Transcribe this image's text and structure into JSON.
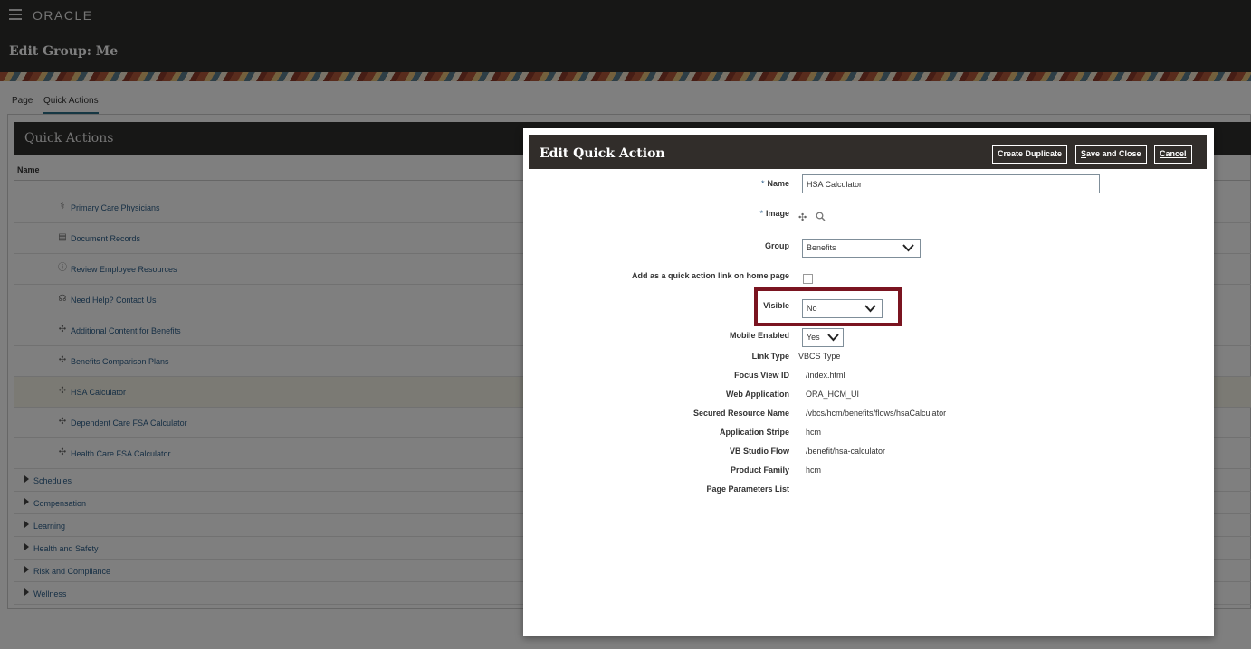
{
  "header": {
    "brand": "ORACLE",
    "page_title": "Edit Group: Me"
  },
  "tabs": [
    {
      "label": "Page",
      "active": false
    },
    {
      "label": "Quick Actions",
      "active": true
    }
  ],
  "panel": {
    "title": "Quick Actions",
    "column_header": "Name",
    "items": [
      {
        "label": "Primary Care Physicians",
        "icon": "stethoscope-icon"
      },
      {
        "label": "Document Records",
        "icon": "document-icon"
      },
      {
        "label": "Review Employee Resources",
        "icon": "info-icon"
      },
      {
        "label": "Need Help? Contact Us",
        "icon": "headset-icon"
      },
      {
        "label": "Additional Content for Benefits",
        "icon": "puzzle-icon"
      },
      {
        "label": "Benefits Comparison Plans",
        "icon": "puzzle-icon"
      },
      {
        "label": "HSA Calculator",
        "icon": "puzzle-icon",
        "selected": true
      },
      {
        "label": "Dependent Care FSA Calculator",
        "icon": "puzzle-icon"
      },
      {
        "label": "Health Care FSA Calculator",
        "icon": "puzzle-icon"
      }
    ],
    "groups": [
      "Schedules",
      "Compensation",
      "Learning",
      "Health and Safety",
      "Risk and Compliance",
      "Wellness"
    ]
  },
  "dialog": {
    "title": "Edit Quick Action",
    "buttons": {
      "create_duplicate": "Create Duplicate",
      "save_close_accel": "S",
      "save_close_rest": "ave and Close",
      "cancel_accel": "C",
      "cancel_rest": "ancel"
    },
    "fields": {
      "name_label": "Name",
      "name_value": "HSA Calculator",
      "image_label": "Image",
      "group_label": "Group",
      "group_value": "Benefits",
      "home_link_label": "Add as a quick action link on home page",
      "visible_label": "Visible",
      "visible_value": "No",
      "mobile_label": "Mobile Enabled",
      "mobile_value": "Yes",
      "link_type_label": "Link Type",
      "link_type_value": "VBCS Type",
      "focus_view_label": "Focus View ID",
      "focus_view_value": "/index.html",
      "web_app_label": "Web Application",
      "web_app_value": "ORA_HCM_UI",
      "secured_label": "Secured Resource Name",
      "secured_value": "/vbcs/hcm/benefits/flows/hsaCalculator",
      "stripe_label": "Application Stripe",
      "stripe_value": "hcm",
      "vb_flow_label": "VB Studio Flow",
      "vb_flow_value": "/benefit/hsa-calculator",
      "product_family_label": "Product Family",
      "product_family_value": "hcm",
      "page_params_label": "Page Parameters List",
      "required_marker": "*"
    }
  },
  "colors": {
    "topbar": "#2f2e2c",
    "link": "#2d5f8a",
    "highlight_border": "#7a1420"
  }
}
